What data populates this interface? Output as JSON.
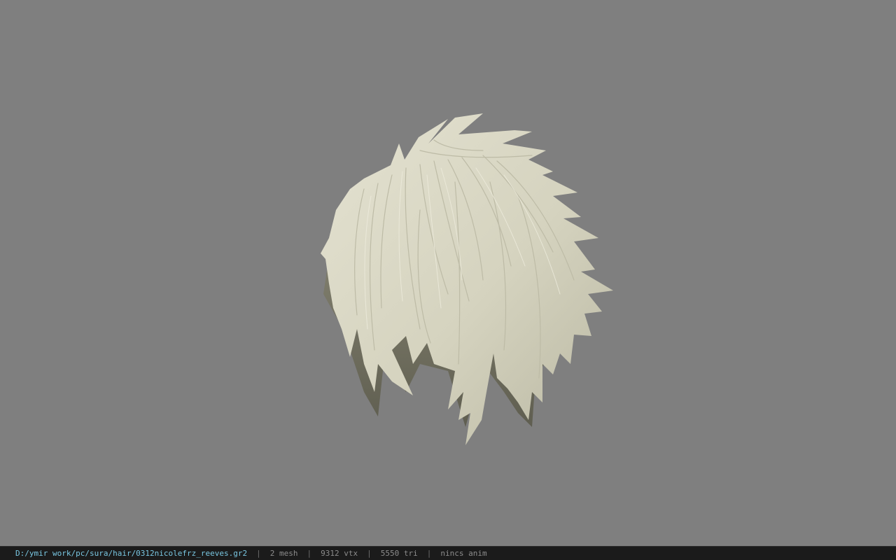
{
  "viewport": {
    "background_color": "#7f7f7f",
    "model": {
      "subject": "hair-mesh",
      "hair_color": "#d9d7c4",
      "shadow_color": "#7a7865"
    }
  },
  "statusbar": {
    "file_path": "D:/ymir work/pc/sura/hair/0312nicolefrz_reeves.gr2",
    "separator": "|",
    "mesh_count": "2 mesh",
    "vertex_count": "9312 vtx",
    "triangle_count": "5550 tri",
    "anim_status": "nincs anim",
    "path_color": "#79c7e2",
    "text_color": "#8c8c8c"
  }
}
